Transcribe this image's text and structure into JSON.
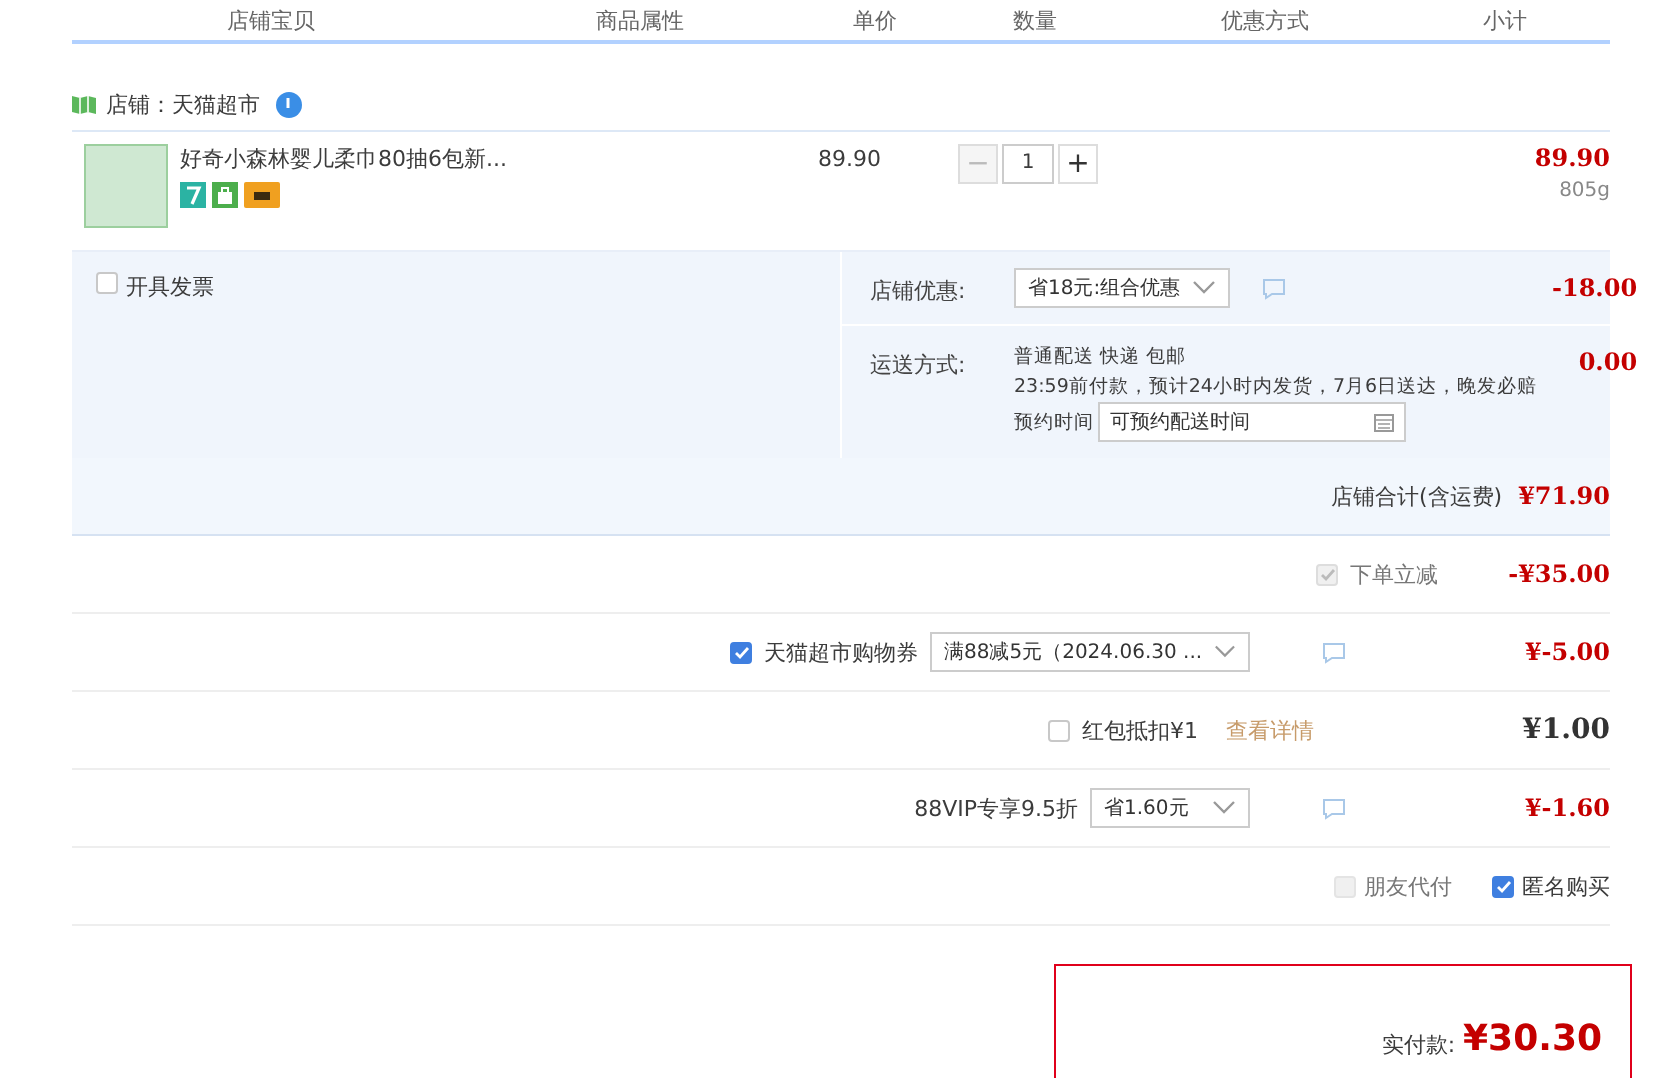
{
  "columns": [
    "店铺宝贝",
    "商品属性",
    "单价",
    "数量",
    "优惠方式",
    "小计"
  ],
  "shop": {
    "label": "店铺：天猫超市"
  },
  "item": {
    "title": "好奇小森林婴儿柔巾80抽6包新...",
    "price": "89.90",
    "quantity": "1",
    "minus": "−",
    "plus": "+",
    "subtotal": "89.90",
    "weight": "805g"
  },
  "invoice": {
    "label": "开具发票",
    "checked": false
  },
  "shop_discount": {
    "label": "店铺优惠:",
    "value": "省18元:组合优惠",
    "amount": "-18.00"
  },
  "shipping": {
    "label": "运送方式:",
    "method": "普通配送 快递 包邮",
    "note": "23:59前付款，预计24小时内发货，7月6日送达，晚发必赔",
    "schedule_label": "预约时间",
    "schedule_placeholder": "可预约配送时间",
    "amount": "0.00"
  },
  "shop_total": {
    "label": "店铺合计(含运费)",
    "amount": "¥71.90"
  },
  "discounts": [
    {
      "kind": "check",
      "label": "下单立减",
      "checked": true,
      "disabled": true,
      "amount": "-¥35.00"
    },
    {
      "kind": "select",
      "label": "天猫超市购物券",
      "checked": true,
      "value": "满88减5元（2024.06.30 ...",
      "amount": "¥-5.00"
    },
    {
      "kind": "link",
      "label": "红包抵扣¥1",
      "checked": false,
      "link": "查看详情",
      "amount": "¥1.00"
    },
    {
      "kind": "select",
      "label": "88VIP专享9.5折",
      "value": "省1.60元",
      "amount": "¥-1.60"
    }
  ],
  "options": [
    {
      "label": "朋友代付",
      "checked": false,
      "disabled": true
    },
    {
      "label": "匿名购买",
      "checked": true,
      "disabled": false
    }
  ],
  "payment": {
    "label": "实付款:",
    "amount": "¥30.30"
  }
}
